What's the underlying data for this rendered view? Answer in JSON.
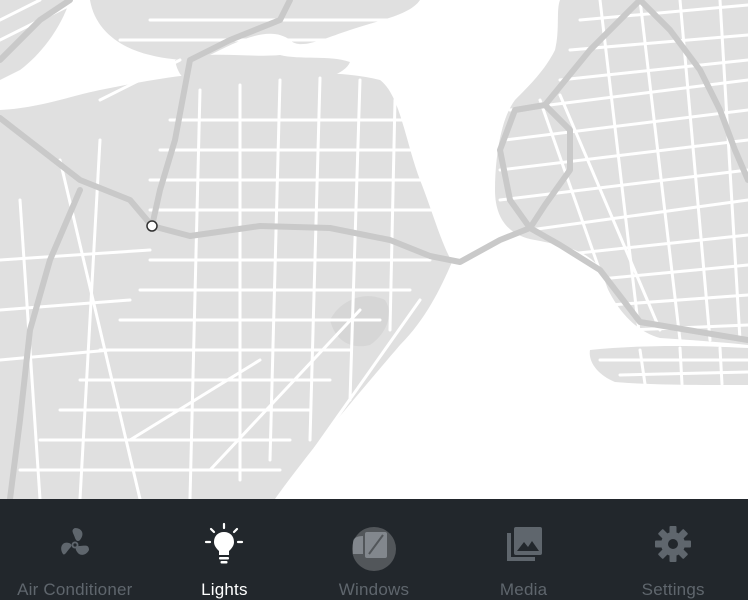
{
  "colors": {
    "nav_background": "#22272c",
    "nav_icon_inactive": "#5f666d",
    "nav_label_active": "#ffffff",
    "land": "#e0e0e0",
    "water": "#ffffff",
    "road": "#ffffff",
    "highway": "#c9c9c9"
  },
  "map": {
    "style": "light-grey",
    "marker": "location-dot"
  },
  "nav": {
    "active": "lights",
    "items": [
      {
        "id": "air-conditioner",
        "label": "Air Conditioner",
        "icon": "fan-icon"
      },
      {
        "id": "lights",
        "label": "Lights",
        "icon": "lightbulb-icon"
      },
      {
        "id": "windows",
        "label": "Windows",
        "icon": "window-icon"
      },
      {
        "id": "media",
        "label": "Media",
        "icon": "photo-library-icon"
      },
      {
        "id": "settings",
        "label": "Settings",
        "icon": "gear-icon"
      }
    ]
  }
}
